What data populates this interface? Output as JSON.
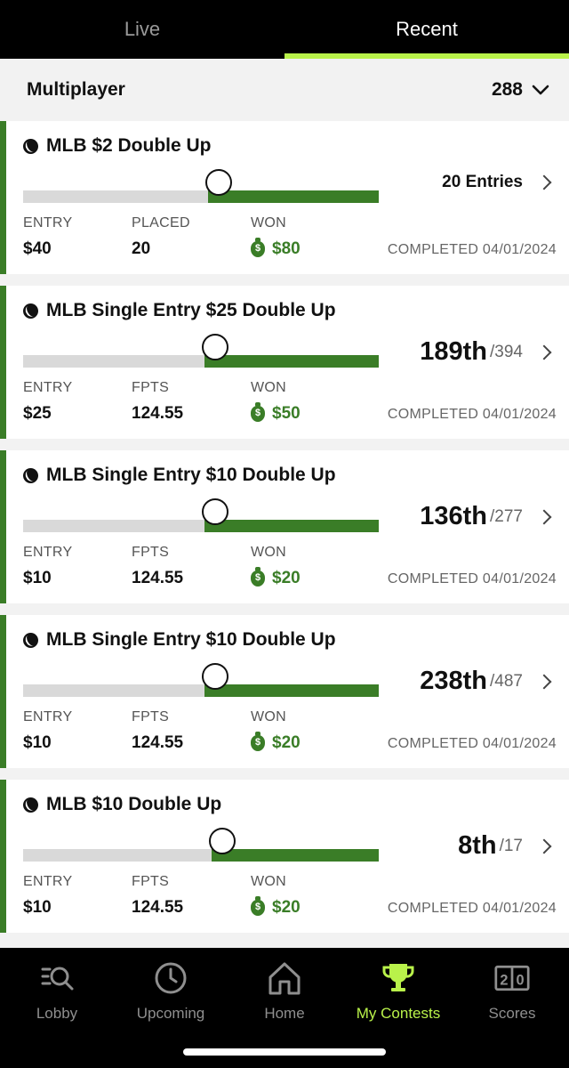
{
  "tabs": {
    "live": "Live",
    "recent": "Recent"
  },
  "section": {
    "title": "Multiplayer",
    "count": "288"
  },
  "labels": {
    "entry": "ENTRY",
    "won": "WON",
    "currency_symbol": "$"
  },
  "contests": [
    {
      "title": "MLB $2 Double Up",
      "progress": 0.52,
      "rank": "",
      "rank_total": "",
      "entries_text": "20 Entries",
      "entry": "$40",
      "mid_label": "PLACED",
      "mid_value": "20",
      "won": "$80",
      "completed": "COMPLETED 04/01/2024"
    },
    {
      "title": "MLB Single Entry $25 Double Up",
      "progress": 0.51,
      "rank": "189th",
      "rank_total": "/394",
      "entries_text": "",
      "entry": "$25",
      "mid_label": "FPTS",
      "mid_value": "124.55",
      "won": "$50",
      "completed": "COMPLETED 04/01/2024"
    },
    {
      "title": "MLB Single Entry $10 Double Up",
      "progress": 0.51,
      "rank": "136th",
      "rank_total": "/277",
      "entries_text": "",
      "entry": "$10",
      "mid_label": "FPTS",
      "mid_value": "124.55",
      "won": "$20",
      "completed": "COMPLETED 04/01/2024"
    },
    {
      "title": "MLB Single Entry $10 Double Up",
      "progress": 0.51,
      "rank": "238th",
      "rank_total": "/487",
      "entries_text": "",
      "entry": "$10",
      "mid_label": "FPTS",
      "mid_value": "124.55",
      "won": "$20",
      "completed": "COMPLETED 04/01/2024"
    },
    {
      "title": "MLB $10 Double Up",
      "progress": 0.53,
      "rank": "8th",
      "rank_total": "/17",
      "entries_text": "",
      "entry": "$10",
      "mid_label": "FPTS",
      "mid_value": "124.55",
      "won": "$20",
      "completed": "COMPLETED 04/01/2024"
    }
  ],
  "nav": {
    "lobby": {
      "label": "Lobby",
      "icon": "lobby-search-icon"
    },
    "upcoming": {
      "label": "Upcoming",
      "icon": "clock-icon"
    },
    "home": {
      "label": "Home",
      "icon": "house-icon"
    },
    "my_contests": {
      "label": "My Contests",
      "icon": "trophy-icon"
    },
    "scores": {
      "label": "Scores",
      "icon": "scoreboard-icon"
    }
  },
  "colors": {
    "accent": "#b9f24a",
    "green": "#3a7d27",
    "track": "#d9d9d9"
  }
}
